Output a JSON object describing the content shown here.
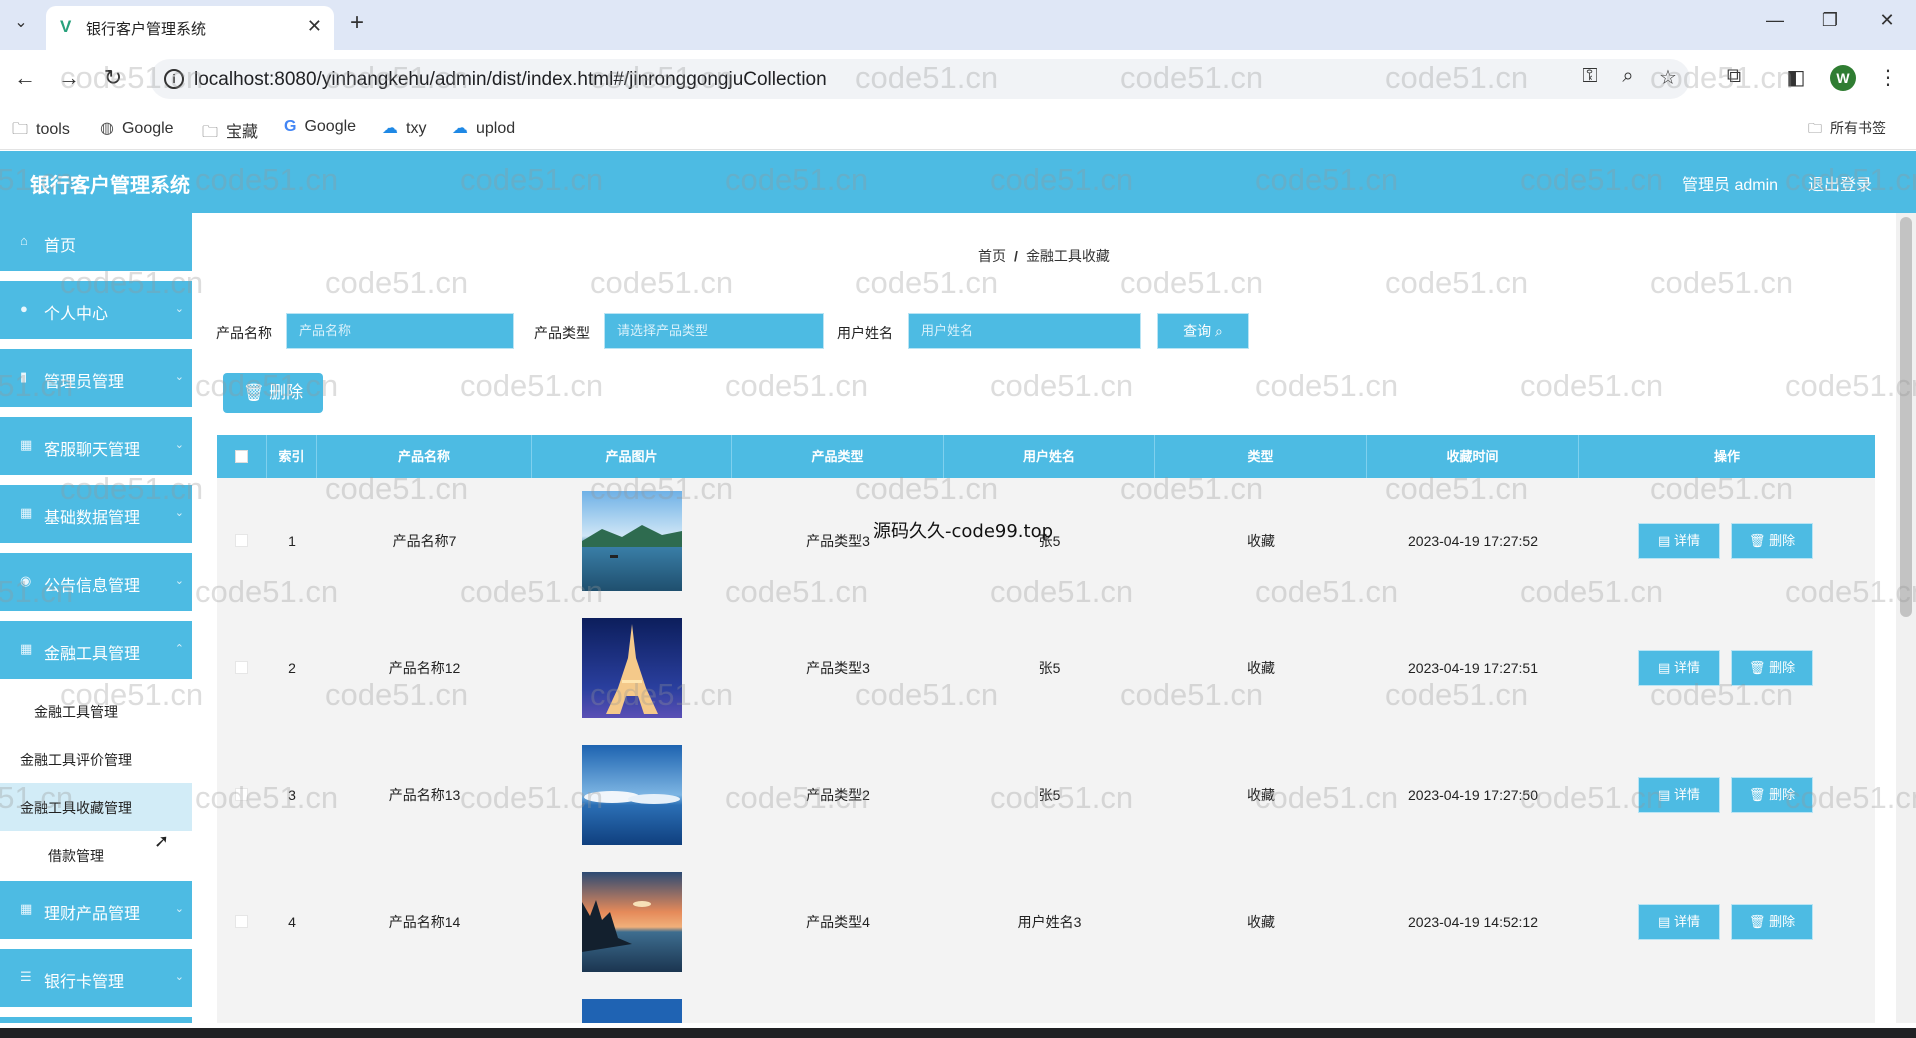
{
  "browser": {
    "tab_title": "银行客户管理系统",
    "url": "localhost:8080/yinhangkehu/admin/dist/index.html#/jinronggongjuCollection",
    "profile_initial": "W",
    "bookmarks": [
      "tools",
      "Google",
      "宝藏",
      "Google",
      "txy",
      "uplod"
    ],
    "all_bookmarks": "所有书签"
  },
  "app": {
    "title": "银行客户管理系统",
    "user": "管理员 admin",
    "logout": "退出登录"
  },
  "sidebar": {
    "menu": [
      {
        "label": "首页",
        "icon": "home-icon"
      },
      {
        "label": "个人中心",
        "icon": "user-icon"
      },
      {
        "label": "管理员管理",
        "icon": "chart-icon"
      },
      {
        "label": "客服聊天管理",
        "icon": "grid-icon"
      },
      {
        "label": "基础数据管理",
        "icon": "grid-icon"
      },
      {
        "label": "公告信息管理",
        "icon": "chat-icon"
      },
      {
        "label": "金融工具管理",
        "icon": "grid-icon"
      }
    ],
    "submenu": [
      "金融工具管理",
      "金融工具评价管理",
      "金融工具收藏管理",
      "借款管理"
    ],
    "menu_after": [
      {
        "label": "理财产品管理",
        "icon": "grid-icon"
      },
      {
        "label": "银行卡管理",
        "icon": "list-icon"
      }
    ]
  },
  "main": {
    "breadcrumb": [
      "首页",
      "金融工具收藏"
    ],
    "filters": [
      {
        "label": "产品名称",
        "placeholder": "产品名称"
      },
      {
        "label": "产品类型",
        "placeholder": "请选择产品类型"
      },
      {
        "label": "用户姓名",
        "placeholder": "用户姓名"
      }
    ],
    "query_label": "查询",
    "delete_label": "删除",
    "columns": [
      "索引",
      "产品名称",
      "产品图片",
      "产品类型",
      "用户姓名",
      "类型",
      "收藏时间",
      "操作"
    ],
    "detail_label": "详情",
    "row_delete_label": "删除",
    "rows": [
      {
        "index": "1",
        "name": "产品名称7",
        "type": "产品类型3",
        "user": "张5",
        "kind": "收藏",
        "time": "2023-04-19 17:27:52"
      },
      {
        "index": "2",
        "name": "产品名称12",
        "type": "产品类型3",
        "user": "张5",
        "kind": "收藏",
        "time": "2023-04-19 17:27:51"
      },
      {
        "index": "3",
        "name": "产品名称13",
        "type": "产品类型2",
        "user": "张5",
        "kind": "收藏",
        "time": "2023-04-19 17:27:50"
      },
      {
        "index": "4",
        "name": "产品名称14",
        "type": "产品类型4",
        "user": "用户姓名3",
        "kind": "收藏",
        "time": "2023-04-19 14:52:12"
      }
    ]
  },
  "overlay": {
    "watermark_center": "源码久久-code99.top",
    "watermark": "code51.cn"
  },
  "colors": {
    "accent": "#4dbbe3",
    "row_bg": "#f3f3f3",
    "active_submenu": "#d2ecf7"
  }
}
